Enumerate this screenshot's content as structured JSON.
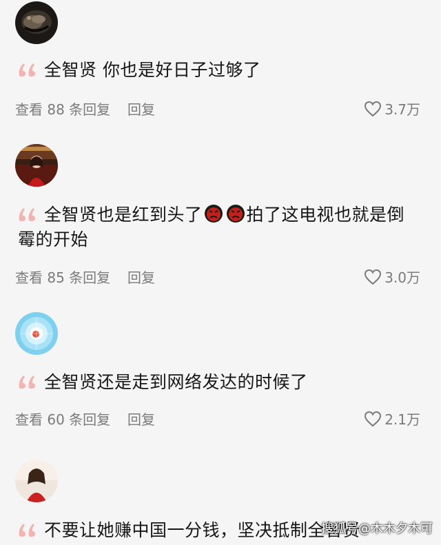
{
  "comments": [
    {
      "avatar": "dark-cat-photo",
      "text_parts": [
        "全智贤 你也是好日子过够了"
      ],
      "view_replies": "查看 88 条回复",
      "reply": "回复",
      "likes": "3.7万"
    },
    {
      "avatar": "woman-red-outfit-photo",
      "text_parts": [
        "全智贤也是红到头了",
        "拍了这电视也就是倒",
        "霉的开始"
      ],
      "emojis": [
        "angry-face-emoji",
        "angry-face-emoji"
      ],
      "view_replies": "查看 85 条回复",
      "reply": "回复",
      "likes": "3.0万"
    },
    {
      "avatar": "blue-glow-orb-photo",
      "text_parts": [
        "全智贤还是走到网络发达的时候了"
      ],
      "view_replies": "查看 60 条回复",
      "reply": "回复",
      "likes": "2.1万"
    },
    {
      "avatar": "woman-red-dress-photo",
      "text_parts": [
        "不要让她赚中国一分钱，坚决抵制全智贤"
      ]
    }
  ],
  "watermark": "搜狐号@木木夕木可",
  "colors": {
    "quote": "#f2b4b0",
    "meta": "#7a7a7a",
    "text": "#161616",
    "background": "#f5f5f6"
  }
}
